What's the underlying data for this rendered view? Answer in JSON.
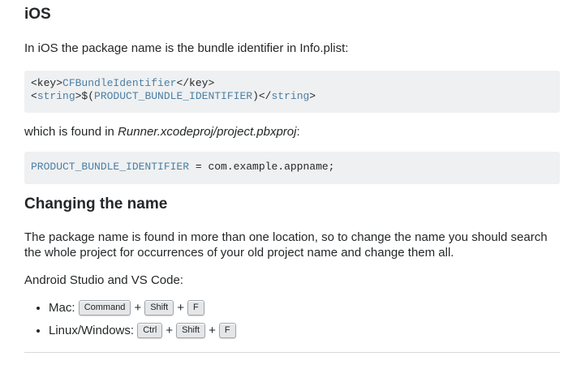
{
  "ios": {
    "heading": "iOS",
    "intro": "In iOS the package name is the bundle identifier in Info.plist:",
    "code1": {
      "line1_open": "<key>",
      "line1_value": "CFBundleIdentifier",
      "line1_close": "</key>",
      "line2_lt": "<",
      "line2_tag": "string",
      "line2_mid": ">$(",
      "line2_var": "PRODUCT_BUNDLE_IDENTIFIER",
      "line2_end": ")</",
      "line2_tag2": "string",
      "line2_gt": ">"
    },
    "found_prefix": "which is found in ",
    "found_path": "Runner.xcodeproj/project.pbxproj",
    "found_suffix": ":",
    "code2": {
      "var": "PRODUCT_BUNDLE_IDENTIFIER",
      "rest": " = com.example.appname;"
    }
  },
  "changing": {
    "heading": "Changing the name",
    "paragraph": "The package name is found in more than one location, so to change the name you should search the whole project for occurrences of your old project name and change them all.",
    "editors": "Android Studio and VS Code:",
    "shortcuts": [
      {
        "label": "Mac:",
        "keys": [
          "Command",
          "Shift",
          "F"
        ]
      },
      {
        "label": "Linux/Windows:",
        "keys": [
          "Ctrl",
          "Shift",
          "F"
        ]
      }
    ],
    "plus": "+"
  }
}
